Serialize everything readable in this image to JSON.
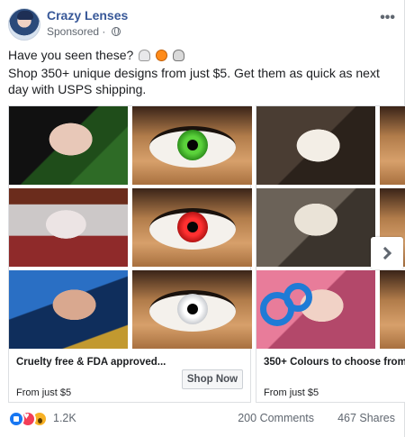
{
  "header": {
    "page_name": "Crazy Lenses",
    "sponsored_label": "Sponsored",
    "dot_sep": "·",
    "more_label": "•••"
  },
  "post": {
    "line1": "Have you seen these?",
    "emojis": [
      "ghost-emoji",
      "pumpkin-emoji",
      "skull-emoji"
    ],
    "line2": "Shop 350+ unique designs from just $5. Get them as quick as next day with USPS shipping."
  },
  "carousel": {
    "cards": [
      {
        "title": "Cruelty free & FDA approved...",
        "subtitle": "From just $5",
        "button_label": "Shop Now",
        "iris_colors": [
          "#3cb521",
          "#e01b1b",
          "#e6e8ea"
        ]
      },
      {
        "title": "350+ Colours to choose from...",
        "subtitle": "From just $5"
      }
    ],
    "next_icon": "chevron-right-icon"
  },
  "footer": {
    "reactions": [
      "like-icon",
      "love-icon",
      "wow-icon"
    ],
    "reaction_count": "1.2K",
    "comments": "200 Comments",
    "shares": "467 Shares"
  },
  "colors": {
    "link_blue": "#385898",
    "like_blue": "#1877f2",
    "love_red": "#f33e58",
    "wow_yellow": "#f7b125"
  }
}
